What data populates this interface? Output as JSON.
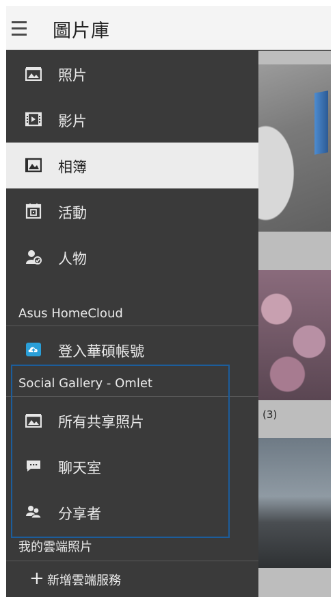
{
  "app_bar": {
    "title": "圖片庫",
    "menu_icon": "hamburger-menu-icon"
  },
  "drawer": {
    "items": [
      {
        "label": "照片",
        "icon": "photo-icon"
      },
      {
        "label": "影片",
        "icon": "film-icon"
      },
      {
        "label": "相簿",
        "icon": "album-icon",
        "selected": true
      },
      {
        "label": "活動",
        "icon": "calendar-icon"
      },
      {
        "label": "人物",
        "icon": "person-icon"
      }
    ],
    "sections": {
      "homecloud": "Asus HomeCloud",
      "social": "Social Gallery - Omlet",
      "cloud": "我的雲端照片"
    },
    "homecloud_items": [
      {
        "label": "登入華碩帳號",
        "icon": "cloud-upload-icon"
      }
    ],
    "social_items": [
      {
        "label": "所有共享照片",
        "icon": "shared-photos-icon"
      },
      {
        "label": "聊天室",
        "icon": "chat-icon"
      },
      {
        "label": "分享者",
        "icon": "sharers-icon"
      }
    ],
    "add_service": "新增雲端服務",
    "add_icon": "plus-icon"
  },
  "background": {
    "album_count": "(3)"
  },
  "colors": {
    "drawer_bg": "#3a3a3a",
    "selected_bg": "#ececec",
    "highlight_border": "#1c5d9b",
    "cloud_icon": "#2a9fd8"
  }
}
